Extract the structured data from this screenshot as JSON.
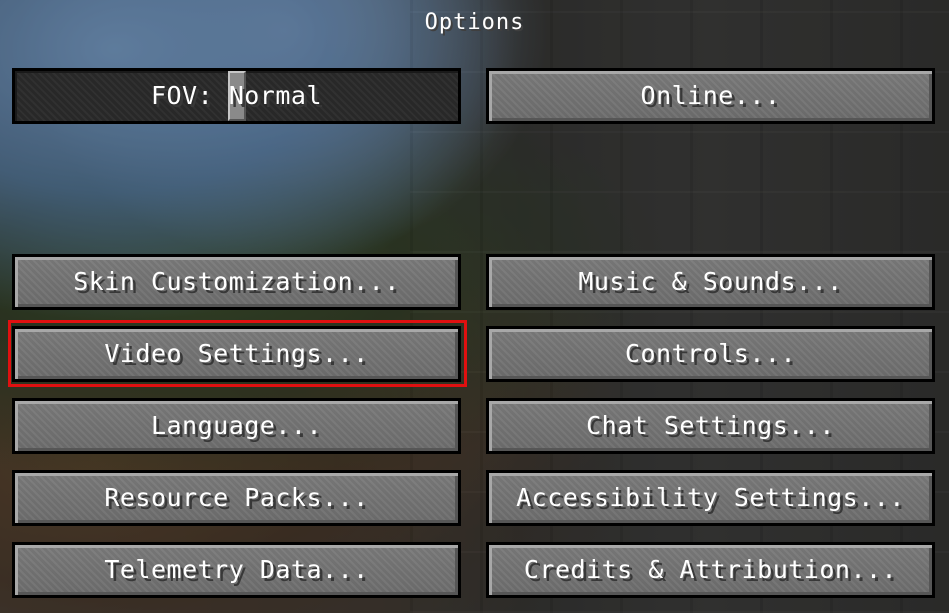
{
  "screen": {
    "title": "Options"
  },
  "fov_slider": {
    "label": "FOV: Normal",
    "value_fraction": 0.5
  },
  "buttons": {
    "online": "Online...",
    "skin_customization": "Skin Customization...",
    "music_sounds": "Music & Sounds...",
    "video_settings": "Video Settings...",
    "controls": "Controls...",
    "language": "Language...",
    "chat_settings": "Chat Settings...",
    "resource_packs": "Resource Packs...",
    "accessibility_settings": "Accessibility Settings...",
    "telemetry_data": "Telemetry Data...",
    "credits_attribution": "Credits & Attribution..."
  },
  "highlight": {
    "target": "Video Settings...",
    "color": "#e01010"
  }
}
